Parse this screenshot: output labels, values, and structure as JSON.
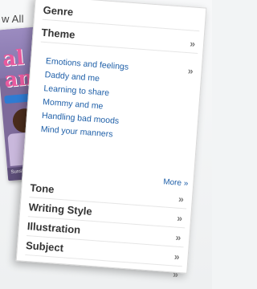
{
  "corner_text": "w All",
  "book": {
    "title_line1": "al",
    "title_line2": "an",
    "strip_text": "Sunshine Carr"
  },
  "menu": {
    "genre": {
      "label": "Genre"
    },
    "theme": {
      "label": "Theme",
      "chevron": "»",
      "items": [
        "Emotions and feelings",
        "Daddy and me",
        "Learning to share",
        "Mommy and me",
        "Handling bad moods",
        "Mind your manners"
      ],
      "items_chevron": "»",
      "more_label": "More »"
    },
    "tone": {
      "label": "Tone",
      "chevron": "»"
    },
    "writing_style": {
      "label": "Writing Style",
      "chevron": "»"
    },
    "illustration": {
      "label": "Illustration",
      "chevron": "»"
    },
    "subject": {
      "label": "Subject",
      "chevron": "»"
    },
    "extra_chevron": "»"
  }
}
